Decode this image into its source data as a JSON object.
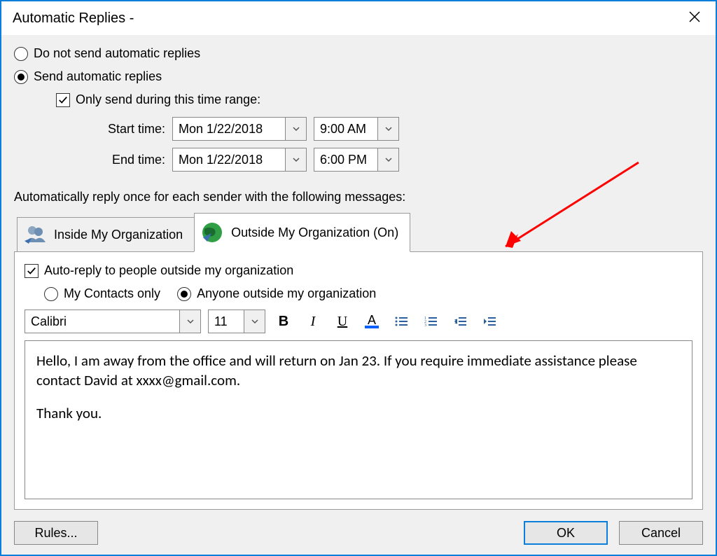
{
  "window": {
    "title": "Automatic Replies -"
  },
  "options": {
    "do_not_send_label": "Do not send automatic replies",
    "send_label": "Send automatic replies",
    "only_range_label": "Only send during this time range:",
    "start_label": "Start time:",
    "end_label": "End time:",
    "start_date": "Mon 1/22/2018",
    "start_time": "9:00 AM",
    "end_date": "Mon 1/22/2018",
    "end_time": "6:00 PM"
  },
  "section_label": "Automatically reply once for each sender with the following messages:",
  "tabs": {
    "inside_label": "Inside My Organization",
    "outside_label": "Outside My Organization (On)"
  },
  "outside": {
    "auto_reply_label": "Auto-reply to people outside my organization",
    "contacts_only_label": "My Contacts only",
    "anyone_label": "Anyone outside my organization"
  },
  "format": {
    "font_name": "Calibri",
    "font_size": "11",
    "bold": "B",
    "italic": "I",
    "underline": "U",
    "fontcolor_A": "A"
  },
  "message": {
    "body": "Hello, I am away from the office and will return on Jan 23. If you require immediate assistance please contact David at xxxx@gmail.com.",
    "signoff": "Thank you."
  },
  "buttons": {
    "rules": "Rules...",
    "ok": "OK",
    "cancel": "Cancel"
  }
}
